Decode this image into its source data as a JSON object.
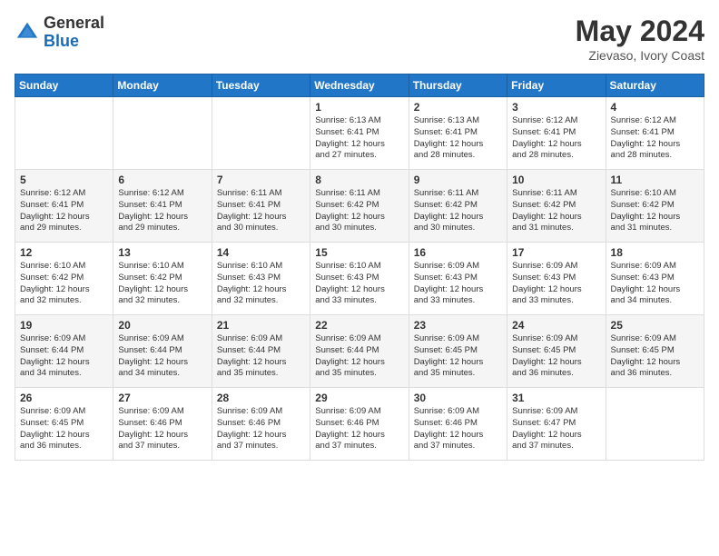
{
  "header": {
    "logo_general": "General",
    "logo_blue": "Blue",
    "month_title": "May 2024",
    "location": "Zievaso, Ivory Coast"
  },
  "days_of_week": [
    "Sunday",
    "Monday",
    "Tuesday",
    "Wednesday",
    "Thursday",
    "Friday",
    "Saturday"
  ],
  "weeks": [
    [
      {
        "day": "",
        "info": ""
      },
      {
        "day": "",
        "info": ""
      },
      {
        "day": "",
        "info": ""
      },
      {
        "day": "1",
        "info": "Sunrise: 6:13 AM\nSunset: 6:41 PM\nDaylight: 12 hours\nand 27 minutes."
      },
      {
        "day": "2",
        "info": "Sunrise: 6:13 AM\nSunset: 6:41 PM\nDaylight: 12 hours\nand 28 minutes."
      },
      {
        "day": "3",
        "info": "Sunrise: 6:12 AM\nSunset: 6:41 PM\nDaylight: 12 hours\nand 28 minutes."
      },
      {
        "day": "4",
        "info": "Sunrise: 6:12 AM\nSunset: 6:41 PM\nDaylight: 12 hours\nand 28 minutes."
      }
    ],
    [
      {
        "day": "5",
        "info": "Sunrise: 6:12 AM\nSunset: 6:41 PM\nDaylight: 12 hours\nand 29 minutes."
      },
      {
        "day": "6",
        "info": "Sunrise: 6:12 AM\nSunset: 6:41 PM\nDaylight: 12 hours\nand 29 minutes."
      },
      {
        "day": "7",
        "info": "Sunrise: 6:11 AM\nSunset: 6:41 PM\nDaylight: 12 hours\nand 30 minutes."
      },
      {
        "day": "8",
        "info": "Sunrise: 6:11 AM\nSunset: 6:42 PM\nDaylight: 12 hours\nand 30 minutes."
      },
      {
        "day": "9",
        "info": "Sunrise: 6:11 AM\nSunset: 6:42 PM\nDaylight: 12 hours\nand 30 minutes."
      },
      {
        "day": "10",
        "info": "Sunrise: 6:11 AM\nSunset: 6:42 PM\nDaylight: 12 hours\nand 31 minutes."
      },
      {
        "day": "11",
        "info": "Sunrise: 6:10 AM\nSunset: 6:42 PM\nDaylight: 12 hours\nand 31 minutes."
      }
    ],
    [
      {
        "day": "12",
        "info": "Sunrise: 6:10 AM\nSunset: 6:42 PM\nDaylight: 12 hours\nand 32 minutes."
      },
      {
        "day": "13",
        "info": "Sunrise: 6:10 AM\nSunset: 6:42 PM\nDaylight: 12 hours\nand 32 minutes."
      },
      {
        "day": "14",
        "info": "Sunrise: 6:10 AM\nSunset: 6:43 PM\nDaylight: 12 hours\nand 32 minutes."
      },
      {
        "day": "15",
        "info": "Sunrise: 6:10 AM\nSunset: 6:43 PM\nDaylight: 12 hours\nand 33 minutes."
      },
      {
        "day": "16",
        "info": "Sunrise: 6:09 AM\nSunset: 6:43 PM\nDaylight: 12 hours\nand 33 minutes."
      },
      {
        "day": "17",
        "info": "Sunrise: 6:09 AM\nSunset: 6:43 PM\nDaylight: 12 hours\nand 33 minutes."
      },
      {
        "day": "18",
        "info": "Sunrise: 6:09 AM\nSunset: 6:43 PM\nDaylight: 12 hours\nand 34 minutes."
      }
    ],
    [
      {
        "day": "19",
        "info": "Sunrise: 6:09 AM\nSunset: 6:44 PM\nDaylight: 12 hours\nand 34 minutes."
      },
      {
        "day": "20",
        "info": "Sunrise: 6:09 AM\nSunset: 6:44 PM\nDaylight: 12 hours\nand 34 minutes."
      },
      {
        "day": "21",
        "info": "Sunrise: 6:09 AM\nSunset: 6:44 PM\nDaylight: 12 hours\nand 35 minutes."
      },
      {
        "day": "22",
        "info": "Sunrise: 6:09 AM\nSunset: 6:44 PM\nDaylight: 12 hours\nand 35 minutes."
      },
      {
        "day": "23",
        "info": "Sunrise: 6:09 AM\nSunset: 6:45 PM\nDaylight: 12 hours\nand 35 minutes."
      },
      {
        "day": "24",
        "info": "Sunrise: 6:09 AM\nSunset: 6:45 PM\nDaylight: 12 hours\nand 36 minutes."
      },
      {
        "day": "25",
        "info": "Sunrise: 6:09 AM\nSunset: 6:45 PM\nDaylight: 12 hours\nand 36 minutes."
      }
    ],
    [
      {
        "day": "26",
        "info": "Sunrise: 6:09 AM\nSunset: 6:45 PM\nDaylight: 12 hours\nand 36 minutes."
      },
      {
        "day": "27",
        "info": "Sunrise: 6:09 AM\nSunset: 6:46 PM\nDaylight: 12 hours\nand 37 minutes."
      },
      {
        "day": "28",
        "info": "Sunrise: 6:09 AM\nSunset: 6:46 PM\nDaylight: 12 hours\nand 37 minutes."
      },
      {
        "day": "29",
        "info": "Sunrise: 6:09 AM\nSunset: 6:46 PM\nDaylight: 12 hours\nand 37 minutes."
      },
      {
        "day": "30",
        "info": "Sunrise: 6:09 AM\nSunset: 6:46 PM\nDaylight: 12 hours\nand 37 minutes."
      },
      {
        "day": "31",
        "info": "Sunrise: 6:09 AM\nSunset: 6:47 PM\nDaylight: 12 hours\nand 37 minutes."
      },
      {
        "day": "",
        "info": ""
      }
    ]
  ]
}
